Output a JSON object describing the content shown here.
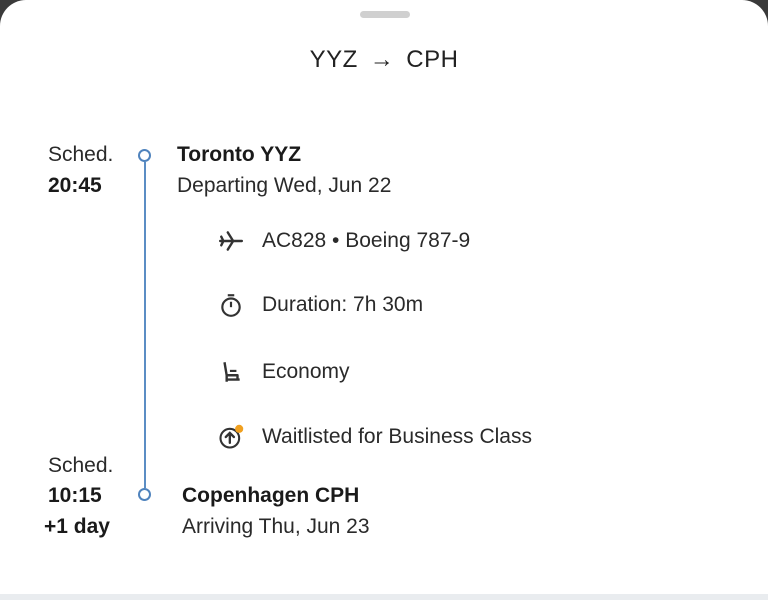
{
  "route": {
    "origin": "YYZ",
    "arrow": "→",
    "destination": "CPH"
  },
  "departure": {
    "sched_label": "Sched.",
    "time": "20:45",
    "airport": "Toronto YYZ",
    "date_text": "Departing Wed, Jun 22"
  },
  "details": {
    "flight": "AC828 • Boeing 787-9",
    "duration": "Duration: 7h 30m",
    "cabin": "Economy",
    "upgrade": "Waitlisted for Business Class"
  },
  "arrival": {
    "sched_label": "Sched.",
    "time": "10:15",
    "day_offset": "+1 day",
    "airport": "Copenhagen CPH",
    "date_text": "Arriving Thu, Jun 23"
  },
  "colors": {
    "timeline": "#5b8dc4",
    "upgrade_dot": "#f0a020"
  },
  "icons": [
    "airplane-icon",
    "stopwatch-icon",
    "seat-icon",
    "upgrade-icon"
  ]
}
